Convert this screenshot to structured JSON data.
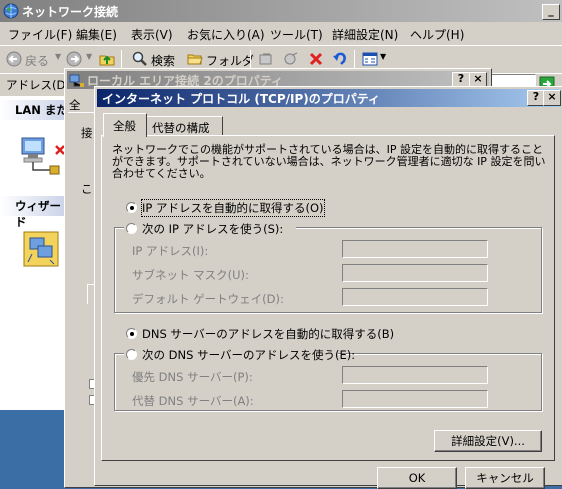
{
  "explorer": {
    "title": "ネットワーク接続",
    "menu": [
      "ファイル(F)",
      "編集(E)",
      "表示(V)",
      "お気に入り(A)",
      "ツール(T)",
      "詳細設定(N)",
      "ヘルプ(H)"
    ],
    "toolbar": {
      "back": "戻る",
      "search": "検索",
      "folders": "フォルダ"
    },
    "address_label": "アドレス(D)",
    "side_lan_header": "LAN また",
    "side_wizard_header": "ウィザード"
  },
  "local_area_dialog": {
    "title": "ローカル エリア接続 2のプロパティ",
    "help": "?",
    "close": "×",
    "tab_fragment": "全",
    "fragment_1": "接",
    "fragment_2": "こ"
  },
  "tcpip_dialog": {
    "title": "インターネット プロトコル (TCP/IP)のプロパティ",
    "help": "?",
    "close": "×",
    "tabs": [
      "全般",
      "代替の構成"
    ],
    "description": "ネットワークでこの機能がサポートされている場合は、IP 設定を自動的に取得することができます。サポートされていない場合は、ネットワーク管理者に適切な IP 設定を問い合わせてください。",
    "ip_auto": "IP アドレスを自動的に取得する(O)",
    "ip_manual": "次の IP アドレスを使う(S):",
    "ip_address_label": "IP アドレス(I):",
    "subnet_label": "サブネット マスク(U):",
    "gateway_label": "デフォルト ゲートウェイ(D):",
    "dns_auto": "DNS サーバーのアドレスを自動的に取得する(B)",
    "dns_manual": "次の DNS サーバーのアドレスを使う(E):",
    "preferred_dns_label": "優先 DNS サーバー(P):",
    "alternate_dns_label": "代替 DNS サーバー(A):",
    "advanced_button": "詳細設定(V)...",
    "ok_button": "OK",
    "cancel_button": "キャンセル"
  }
}
